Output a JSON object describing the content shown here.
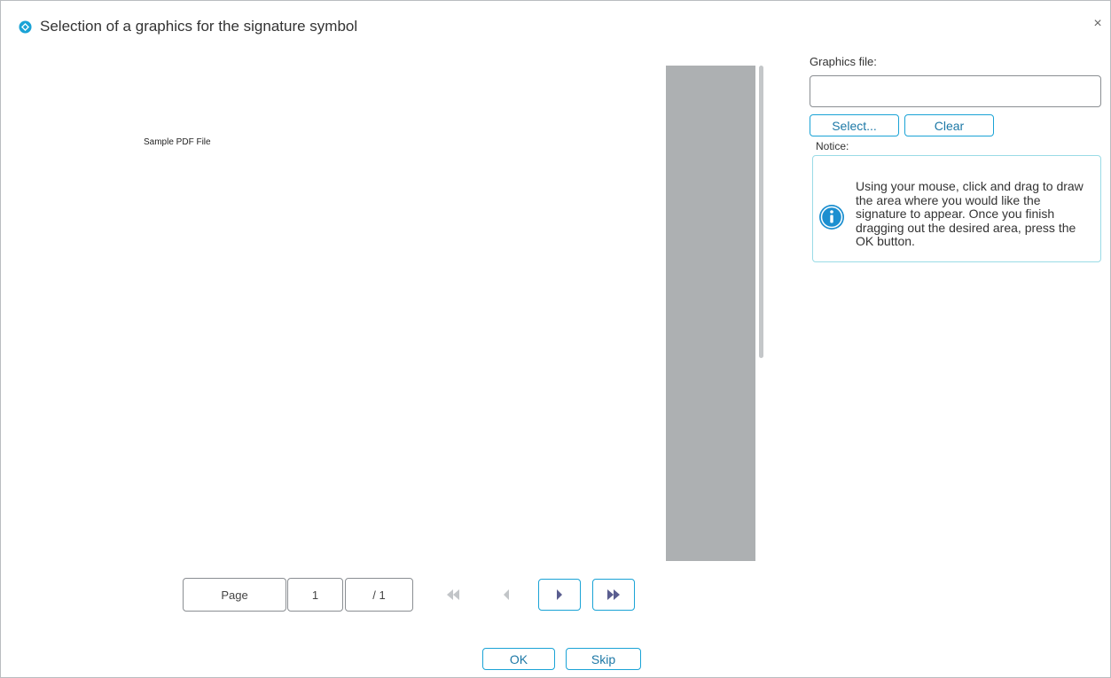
{
  "window": {
    "title": "Selection of a graphics for the signature symbol",
    "close_glyph": "×",
    "app_icon": "compass-diamond-icon",
    "accent_color": "#1aa3d6"
  },
  "preview": {
    "page_text": "Sample PDF File"
  },
  "navigation": {
    "page_label": "Page",
    "current_page": "1",
    "total_pages": "/ 1",
    "first_icon": "double-chevron-left-icon",
    "prev_icon": "chevron-left-icon",
    "next_icon": "chevron-right-icon",
    "last_icon": "double-chevron-right-icon"
  },
  "graphics": {
    "label": "Graphics file:",
    "value": "",
    "select_label": "Select...",
    "clear_label": "Clear"
  },
  "notice": {
    "label": "Notice:",
    "icon": "info-icon",
    "text": "Using your mouse, click and drag to draw the area where you would like the signature to appear. Once you finish dragging out the desired area, press the OK button."
  },
  "footer": {
    "ok_label": "OK",
    "skip_label": "Skip"
  }
}
